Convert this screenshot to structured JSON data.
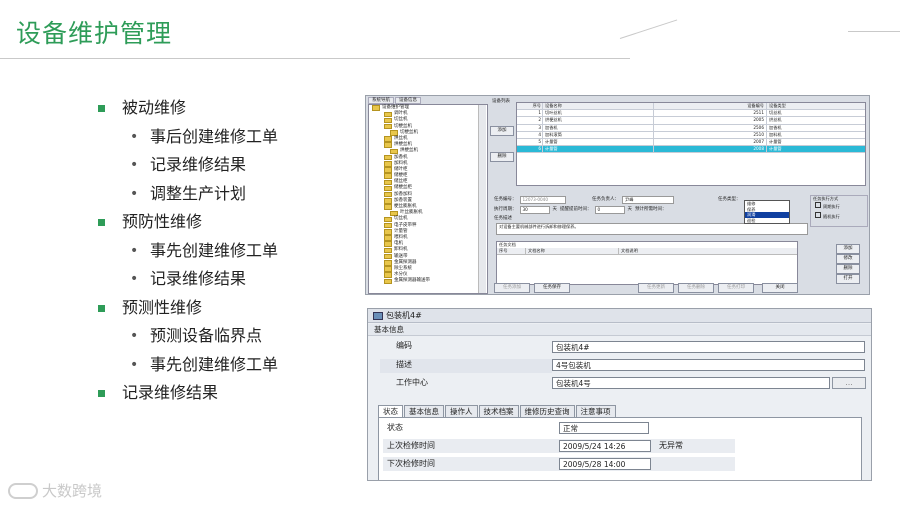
{
  "slide": {
    "title": "设备维护管理",
    "outline": [
      {
        "level": 1,
        "text": "被动维修"
      },
      {
        "level": 2,
        "text": "事后创建维修工单"
      },
      {
        "level": 2,
        "text": "记录维修结果"
      },
      {
        "level": 2,
        "text": "调整生产计划"
      },
      {
        "level": 1,
        "text": "预防性维修"
      },
      {
        "level": 2,
        "text": "事先创建维修工单"
      },
      {
        "level": 2,
        "text": "记录维修结果"
      },
      {
        "level": 1,
        "text": "预测性维修"
      },
      {
        "level": 2,
        "text": "预测设备临界点"
      },
      {
        "level": 2,
        "text": "事先创建维修工单"
      },
      {
        "level": 1,
        "text": "记录维修结果"
      }
    ],
    "watermark": "大数跨境",
    "accent_color": "#2e9c58"
  },
  "screenshot_top": {
    "tabs": [
      "系统导航",
      "设备信息"
    ],
    "tree_root": "设备维护管理",
    "tree_items": [
      "调叶机",
      "切丝机",
      "切梗丝机",
      "切梗丝机",
      "烘丝机",
      "烘梗丝机",
      "烘梗丝机",
      "加香机",
      "加料机",
      "储叶柜",
      "储梗柜",
      "储丝柜",
      "储梗丝柜",
      "加香加料",
      "加香装置",
      "梗丝膨胀机",
      "叶丝膨胀机",
      "切丝机",
      "电子皮带秤",
      "计量管",
      "喂料机",
      "电机",
      "卸料机",
      "输送带",
      "金属探测器",
      "除尘系统",
      "水分仪",
      "金属探测器输送带"
    ],
    "grid_label": "设备列表",
    "grid_headers": [
      "序号",
      "设备名称",
      "设备编号",
      "设备类型"
    ],
    "grid_rows": [
      [
        "1",
        "切叶丝机",
        "2511",
        "切丝机"
      ],
      [
        "2",
        "烘梗丝机",
        "2005",
        "烘丝机"
      ],
      [
        "3",
        "加香机",
        "2506",
        "加香机"
      ],
      [
        "4",
        "加料滚筒",
        "2510",
        "加料机"
      ],
      [
        "5",
        "计量管",
        "2007",
        "计量管"
      ],
      [
        "6",
        "计量管",
        "2008",
        "计量管"
      ]
    ],
    "side_buttons": [
      "添加",
      "删除"
    ],
    "form": {
      "task_no_label": "任务编号：",
      "task_no_value": "12073-0040",
      "owner_label": "任务负责人：",
      "owner_value": "尹峰",
      "type_label": "任务类型：",
      "period_label": "执行周期：",
      "period_value": "30",
      "period_unit": "天",
      "remind_label": "提醒提前时间：",
      "remind_value": "0",
      "remind_unit": "天",
      "estimate_label": "预计所需时间：",
      "desc_label": "任务描述",
      "desc_value": "对设备主要机械部件进行拆卸和修理保养。",
      "exec_method_label": "任务执行方式",
      "exec_options": [
        "周期执行",
        "随机执行"
      ],
      "dropdown_options": [
        "维修",
        "保养",
        "润滑",
        "巡检"
      ],
      "dropdown_selected_index": 2
    },
    "docs": {
      "label": "任务文档",
      "headers": [
        "序号",
        "文档名称",
        "文档说明"
      ],
      "buttons": [
        "添加",
        "修改",
        "删除",
        "打开"
      ]
    },
    "bottom_buttons": [
      "任务添加",
      "任务保存",
      "任务更新",
      "任务删除",
      "任务打印",
      "关闭"
    ]
  },
  "screenshot_bottom": {
    "window_title": "包装机4#",
    "section": "基本信息",
    "fields": [
      {
        "label": "编码",
        "value": "包装机4#"
      },
      {
        "label": "描述",
        "value": "4号包装机"
      },
      {
        "label": "工作中心",
        "value": "包装机4号"
      }
    ],
    "browse_button": "...",
    "tabs": [
      "状态",
      "基本信息",
      "操作人",
      "技术档案",
      "维修历史查询",
      "注意事项"
    ],
    "active_tab": 0,
    "status_rows": [
      {
        "label": "状态",
        "value": "正常",
        "extra": ""
      },
      {
        "label": "上次检修时间",
        "value": "2009/5/24 14:26",
        "extra": "无异常"
      },
      {
        "label": "下次检修时间",
        "value": "2009/5/28 14:00",
        "extra": ""
      }
    ]
  }
}
